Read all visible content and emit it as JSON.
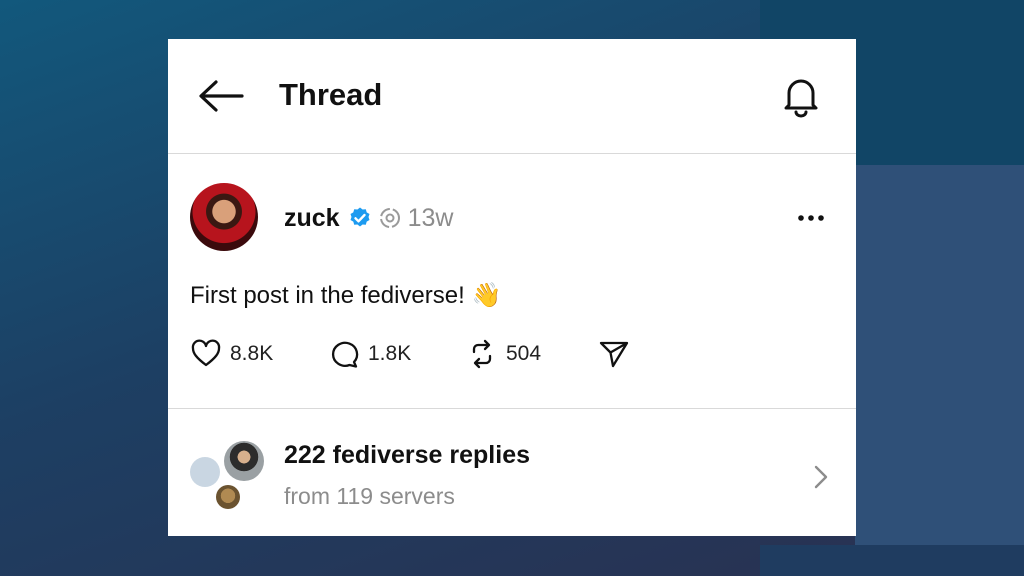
{
  "header": {
    "title": "Thread",
    "back_icon": "arrow-left-icon",
    "bell_icon": "bell-icon"
  },
  "post": {
    "username": "zuck",
    "time_ago": "13w",
    "text": "First post in the fediverse! 👋",
    "icons": {
      "verified": "verified-badge-icon",
      "fediverse": "fediverse-icon",
      "more": "more-options-icon"
    },
    "actions": {
      "likes": "8.8K",
      "replies": "1.8K",
      "reposts": "504"
    }
  },
  "fediverse_replies": {
    "title": "222 fediverse replies",
    "subtitle": "from 119 servers"
  },
  "colors": {
    "verified": "#1d9bf0",
    "muted_text": "#8c8c8c",
    "card": "#ffffff"
  }
}
